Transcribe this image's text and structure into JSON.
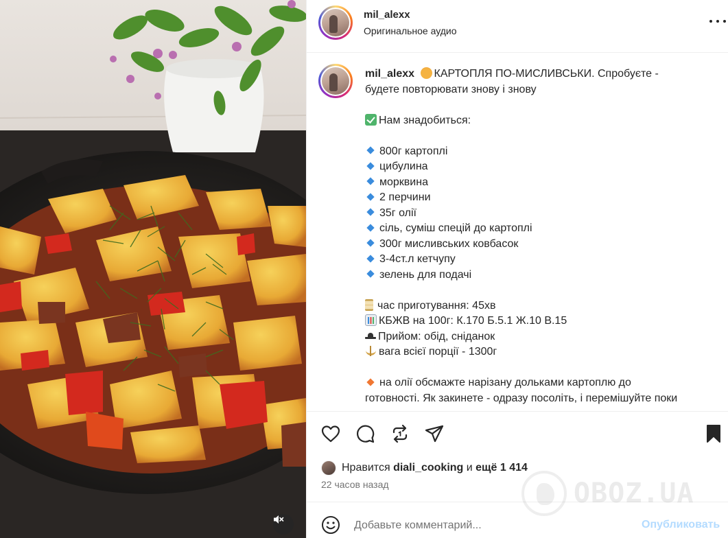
{
  "media": {
    "alt": "Фото блюда"
  },
  "header": {
    "username": "mil_alexx",
    "audio": "Оригинальное аудио"
  },
  "caption": {
    "username": "mil_alexx",
    "title_line1": "КАРТОПЛЯ ПО-МИСЛИВСЬКИ. Спробуєте -",
    "title_line2": "будете повторювати знову і знову",
    "need_heading": "Нам знадобиться:",
    "ingredients": [
      "800г картоплі",
      "цибулина",
      "морквина",
      "2 перчини",
      "35г олії",
      "сіль, суміш спецій до картоплі",
      "300г мисливських ковбасок",
      "3-4ст.л кетчупу",
      "зелень для подачі"
    ],
    "cook_time": "час приготування: 45хв",
    "kbju": "КБЖВ на 100г: К.170 Б.5.1 Ж.10 В.15",
    "meal": "Прийом: обід, сніданок",
    "weight": "вага всієї порції - 1300г",
    "step1_line1": "на олії обсмажте нарізану дольками картоплю до",
    "step1_line2": "готовності. Як закинете - одразу посоліть, і перемішуйте поки"
  },
  "likes": {
    "prefix": "Нравится",
    "user": "diali_cooking",
    "conj": "и",
    "rest": "ещё 1 414"
  },
  "time_ago": "22 часов назад",
  "comment": {
    "placeholder": "Добавьте комментарий...",
    "publish": "Опубликовать"
  },
  "watermark": "OBOZ.UA",
  "colors": {
    "accent_blue": "#0095f6",
    "publish_disabled": "#b3dbff",
    "ingredient_bullet": "#3a8cdd",
    "step_bullet": "#f07733"
  }
}
